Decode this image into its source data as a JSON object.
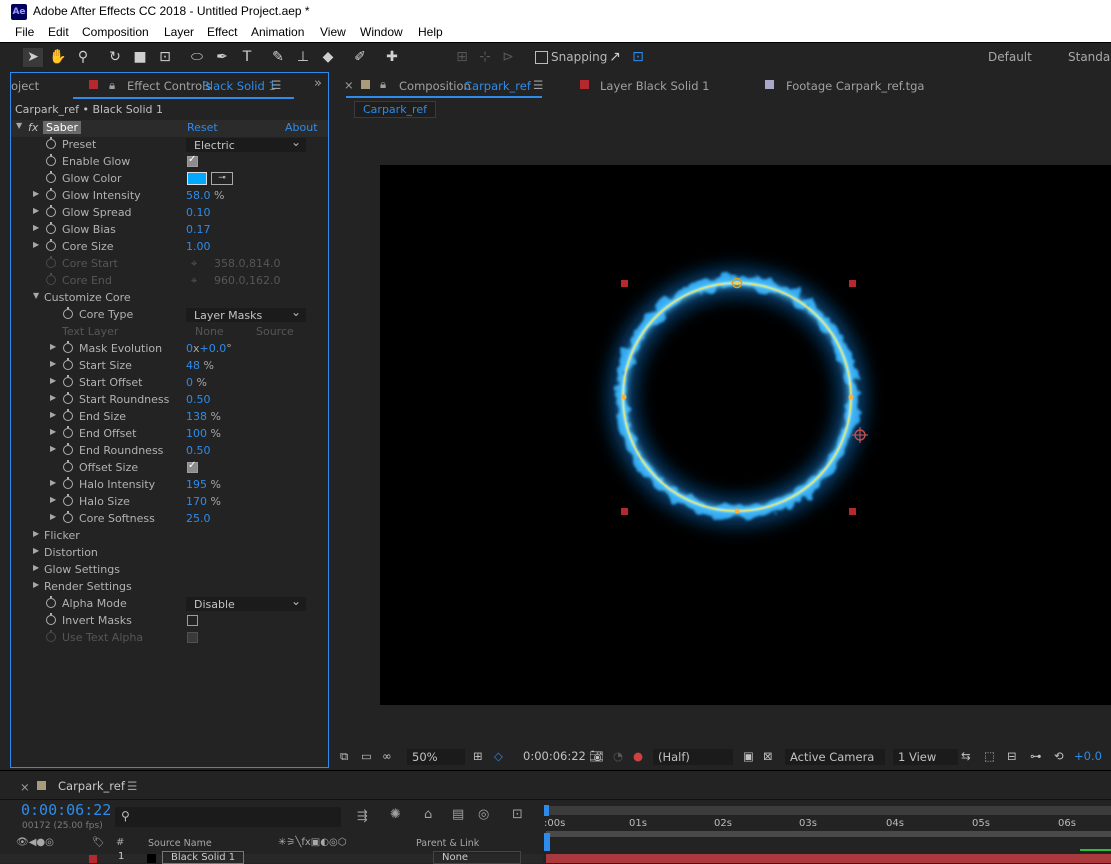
{
  "app": {
    "icon_text": "Ae",
    "title": "Adobe After Effects CC 2018 - Untitled Project.aep *"
  },
  "menu": [
    "File",
    "Edit",
    "Composition",
    "Layer",
    "Effect",
    "Animation",
    "View",
    "Window",
    "Help"
  ],
  "toolbar": {
    "tools": [
      "selection-tool",
      "hand-tool",
      "zoom-tool",
      "rotation-tool",
      "camera-tool",
      "pan-behind-tool",
      "mask-ellipse-tool",
      "pen-tool",
      "text-tool",
      "brush-tool",
      "clone-stamp-tool",
      "eraser-tool",
      "roto-brush-tool",
      "puppet-pin-tool"
    ],
    "snapping_label": "Snapping",
    "workspace_default": "Default",
    "workspace_standard": "Standard"
  },
  "effect_controls": {
    "tab_project": "oject",
    "tab_title_prefix": "Effect Controls",
    "tab_title_layer": "Black Solid 1",
    "breadcrumb": "Carpark_ref • Black Solid 1",
    "effect_name": "Saber",
    "reset_label": "Reset",
    "about_label": "About",
    "props": {
      "preset": {
        "label": "Preset",
        "value": "Electric"
      },
      "enable_glow": {
        "label": "Enable Glow",
        "checked": true
      },
      "glow_color": {
        "label": "Glow Color",
        "color": "#00a8ff"
      },
      "glow_intensity": {
        "label": "Glow Intensity",
        "value": "58.0",
        "unit": "%"
      },
      "glow_spread": {
        "label": "Glow Spread",
        "value": "0.10"
      },
      "glow_bias": {
        "label": "Glow Bias",
        "value": "0.17"
      },
      "core_size": {
        "label": "Core Size",
        "value": "1.00"
      },
      "core_start": {
        "label": "Core Start",
        "value": "358.0,814.0"
      },
      "core_end": {
        "label": "Core End",
        "value": "960.0,162.0"
      },
      "customize_core": {
        "label": "Customize Core"
      },
      "core_type": {
        "label": "Core Type",
        "value": "Layer Masks"
      },
      "text_layer": {
        "label": "Text Layer",
        "value1": "None",
        "value2": "Source"
      },
      "mask_evolution": {
        "label": "Mask Evolution",
        "value_x": "0",
        "x_sep": "x",
        "value_deg": "+0.0",
        "deg_unit": "°"
      },
      "start_size": {
        "label": "Start Size",
        "value": "48",
        "unit": "%"
      },
      "start_offset": {
        "label": "Start Offset",
        "value": "0",
        "unit": "%"
      },
      "start_roundness": {
        "label": "Start Roundness",
        "value": "0.50"
      },
      "end_size": {
        "label": "End Size",
        "value": "138",
        "unit": "%"
      },
      "end_offset": {
        "label": "End Offset",
        "value": "100",
        "unit": "%"
      },
      "end_roundness": {
        "label": "End Roundness",
        "value": "0.50"
      },
      "offset_size": {
        "label": "Offset Size",
        "checked": true
      },
      "halo_intensity": {
        "label": "Halo Intensity",
        "value": "195",
        "unit": "%"
      },
      "halo_size": {
        "label": "Halo Size",
        "value": "170",
        "unit": "%"
      },
      "core_softness": {
        "label": "Core Softness",
        "value": "25.0"
      },
      "flicker": {
        "label": "Flicker"
      },
      "distortion": {
        "label": "Distortion"
      },
      "glow_settings": {
        "label": "Glow Settings"
      },
      "render_settings": {
        "label": "Render Settings"
      },
      "alpha_mode": {
        "label": "Alpha Mode",
        "value": "Disable"
      },
      "invert_masks": {
        "label": "Invert Masks",
        "checked": false
      },
      "use_text_alpha": {
        "label": "Use Text Alpha",
        "checked": true
      }
    }
  },
  "comp_panel": {
    "tab_comp_prefix": "Composition",
    "tab_comp_name": "Carpark_ref",
    "tab_layer": "Layer  Black Solid 1",
    "tab_footage": "Footage  Carpark_ref.tga",
    "sub_tab": "Carpark_ref"
  },
  "viewer_bar": {
    "zoom": "50%",
    "timecode": "0:00:06:22",
    "resolution": "(Half)",
    "camera": "Active Camera",
    "views": "1 View",
    "exposure": "+0.0"
  },
  "timeline": {
    "comp_name": "Carpark_ref",
    "timecode": "0:00:06:22",
    "frame_info": "00172 (25.00 fps)",
    "search_placeholder": "",
    "ruler_labels": [
      ":00s",
      "01s",
      "02s",
      "03s",
      "04s",
      "05s",
      "06s"
    ],
    "col_source": "Source Name",
    "col_parent": "Parent & Link",
    "layer_num": "1",
    "layer_name": "Black Solid 1",
    "parent_value": "None"
  },
  "colors": {
    "accent": "#2d8ceb",
    "label_red": "#b5282e",
    "glow": "#00a8ff"
  }
}
